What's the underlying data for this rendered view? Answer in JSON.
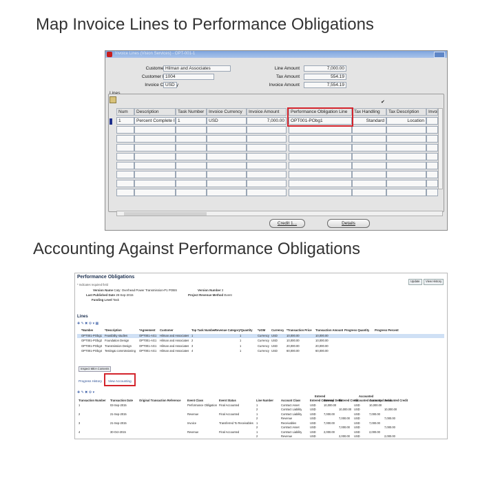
{
  "slide_titles": {
    "top": "Map Invoice Lines to Performance Obligations",
    "bottom": "Accounting Against Performance Obligations"
  },
  "oracle_form": {
    "window_title": "Invoice Lines (Vision Services) - OPT-001-1",
    "header": {
      "customer_name_label": "Customer Name",
      "customer_name": "Hilman and Associates",
      "customer_number_label": "Customer Number",
      "customer_number": "1004",
      "invoice_currency_label": "Invoice Currency",
      "invoice_currency": "USD",
      "line_amount_label": "Line Amount",
      "line_amount": "7,000.00",
      "tax_amount_label": "Tax Amount",
      "tax_amount": "554.19",
      "invoice_amount_label": "Invoice Amount",
      "invoice_amount": "7,554.19"
    },
    "lines_label": "Lines",
    "columns": [
      "Num",
      "Description",
      "Task Number",
      "Invoice Currency",
      "Invoice Amount",
      "Performance Obligation Line",
      "Tax Handling",
      "Tax Description",
      "Invoic"
    ],
    "row": {
      "num": "1",
      "description": "Percent Complete I",
      "task_number": "1",
      "invoice_currency": "USD",
      "invoice_amount": "7,000.00",
      "po_line": "OPT001-PObg1",
      "tax_handling": "Standard",
      "tax_description": "Location"
    },
    "buttons": {
      "credit": "Credit 1...",
      "details": "Details"
    }
  },
  "fusion_page": {
    "title": "Performance Obligations",
    "required_note": "* Indicates required field",
    "buttons": {
      "update": "Update",
      "view_history": "View History"
    },
    "fields": {
      "version_name_label": "Version Name",
      "version_name": "Caty: Overhead Power Transmission-P1 POBS",
      "last_published_label": "Last Published Date",
      "last_published": "28-Sep-2015",
      "funding_level_label": "Funding Level",
      "funding_level": "Task",
      "version_number_label": "Version Number",
      "version_number": "2",
      "project_revenue_method_label": "Project Revenue Method",
      "project_revenue_method": "Event"
    },
    "lines_label": "Lines",
    "lines_columns": [
      "*Number",
      "*Description",
      "*Agreement",
      "Customer",
      "Top Task Number",
      "Revenue Category",
      "*Quantity",
      "*UOM",
      "Currency",
      "*Transaction Price",
      "Transaction Amount",
      "Progress Quantity",
      "Progress Percent"
    ],
    "lines_rows": [
      [
        "OPT001-PObg1",
        "Feasibility studies",
        "OPT001-AG1",
        "Hilman and Associates",
        "1",
        "",
        "1",
        "Currency",
        "USD",
        "10,000.00",
        "10,000.00",
        "",
        ""
      ],
      [
        "OPT001-PObg2",
        "Foundation Design",
        "OPT001-AG1",
        "Hilman and Associates",
        "2",
        "",
        "1",
        "Currency",
        "USD",
        "10,000.00",
        "10,000.00",
        "",
        ""
      ],
      [
        "OPT001-PObg3",
        "Transmission Design",
        "OPT001-AG1",
        "Hilman and Associates",
        "3",
        "",
        "1",
        "Currency",
        "USD",
        "20,000.00",
        "20,000.00",
        "",
        ""
      ],
      [
        "OPT001-PObg4",
        "Testing& commissioning",
        "OPT001-AG1",
        "Hilman and Associates",
        "4",
        "",
        "1",
        "Currency",
        "USD",
        "60,000.00",
        "60,000.00",
        "",
        ""
      ]
    ],
    "inspect_button": "Inspect MEA Contents",
    "tabs": [
      "Progress History",
      "View Accounting"
    ],
    "acct_columns": [
      "Transaction Number",
      "Transaction Date",
      "Original Transaction Reference",
      "Event Class",
      "Event Status",
      "Line Number",
      "Account Class",
      "Entered Currency",
      "Entered Debit",
      "Entered Credit",
      "Accounted Currency",
      "Accounted Debit",
      "Accounted Credit"
    ],
    "acct_group_headers": {
      "entered": "Entered",
      "accounted": "Accounted"
    },
    "acct_rows": [
      [
        "1",
        "03-Sep-2015",
        "",
        "Performance Obligation",
        "Final Accounted",
        "1",
        "Contract Asset",
        "USD",
        "10,000.00",
        "",
        "USD",
        "10,000.00",
        ""
      ],
      [
        "",
        "",
        "",
        "",
        "",
        "2",
        "Contract Liability",
        "USD",
        "",
        "10,000.00",
        "USD",
        "",
        "10,000.00"
      ],
      [
        "2",
        "21-Sep-2015",
        "",
        "Revenue",
        "Final Accounted",
        "1",
        "Contract Liability",
        "USD",
        "7,000.00",
        "",
        "USD",
        "7,000.00",
        ""
      ],
      [
        "",
        "",
        "",
        "",
        "",
        "2",
        "Revenue",
        "USD",
        "",
        "7,000.00",
        "USD",
        "",
        "7,000.00"
      ],
      [
        "3",
        "21-Sep-2015",
        "",
        "Invoice",
        "Transferred To Receivables",
        "1",
        "Receivables",
        "USD",
        "7,000.00",
        "",
        "USD",
        "7,000.00",
        ""
      ],
      [
        "",
        "",
        "",
        "",
        "",
        "2",
        "Contract Asset",
        "USD",
        "",
        "7,000.00",
        "USD",
        "",
        "7,000.00"
      ],
      [
        "4",
        "30-Oct-2015",
        "",
        "Revenue",
        "Final Accounted",
        "1",
        "Contract Liability",
        "USD",
        "2,000.00",
        "",
        "USD",
        "2,000.00",
        ""
      ],
      [
        "",
        "",
        "",
        "",
        "",
        "2",
        "Revenue",
        "USD",
        "",
        "2,000.00",
        "USD",
        "",
        "2,000.00"
      ]
    ]
  }
}
